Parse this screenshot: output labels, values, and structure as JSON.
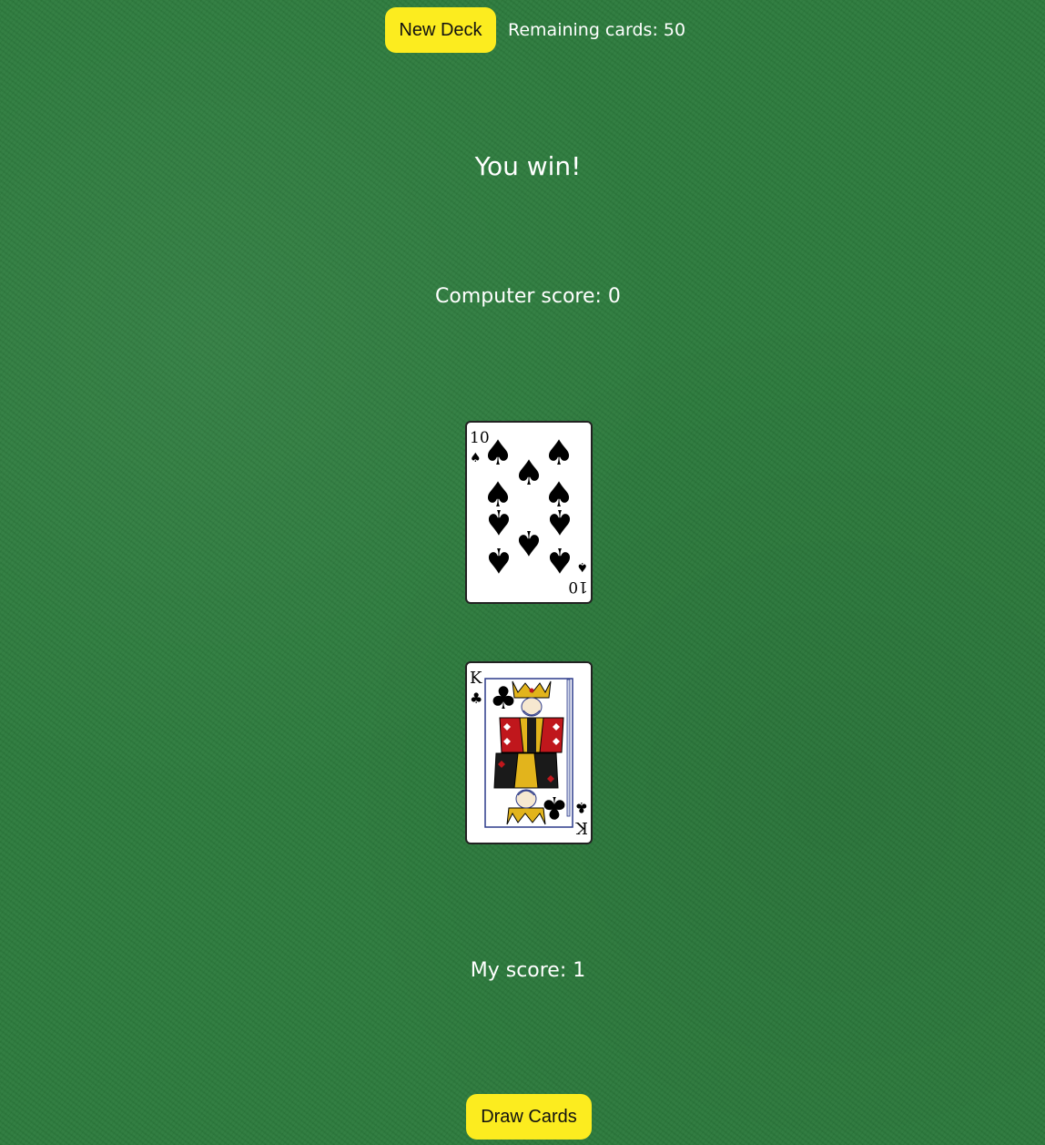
{
  "header": {
    "new_deck_label": "New Deck",
    "remaining_text": "Remaining cards: 50"
  },
  "game": {
    "result_text": "You win!",
    "computer_score_text": "Computer score: 0",
    "my_score_text": "My score: 1",
    "draw_cards_label": "Draw Cards"
  },
  "cards": {
    "computer": {
      "rank": "10",
      "suit": "spades",
      "suit_symbol": "♠"
    },
    "player": {
      "rank": "K",
      "suit": "clubs",
      "suit_symbol": "♣"
    }
  },
  "colors": {
    "table_green": "#2c7a3c",
    "button_yellow": "#fcec1f",
    "text": "#ffffff"
  }
}
